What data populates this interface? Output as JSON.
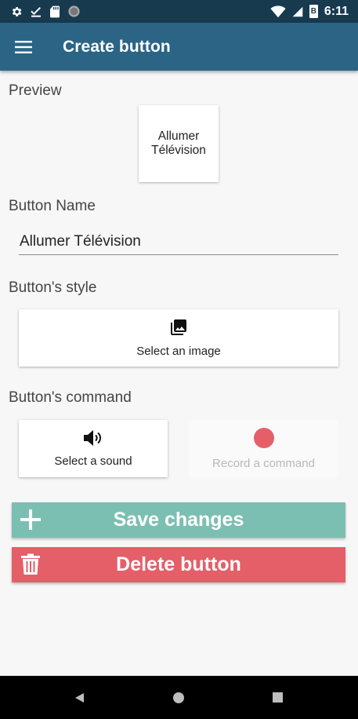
{
  "status_bar": {
    "time": "6:11",
    "battery_glyph": "B",
    "icons": [
      "gear-icon",
      "check-icon",
      "sd-card-icon",
      "circle-icon",
      "wifi-icon",
      "signal-icon",
      "battery-icon"
    ]
  },
  "app_bar": {
    "title": "Create button",
    "menu_icon": "hamburger-menu-icon"
  },
  "preview": {
    "label": "Preview",
    "tile_line1": "Allumer",
    "tile_line2": "Télévision"
  },
  "button_name": {
    "label": "Button Name",
    "value": "Allumer Télévision"
  },
  "style": {
    "label": "Button's style",
    "select_image_label": "Select an image",
    "icon": "photo-library-icon"
  },
  "command": {
    "label": "Button's command",
    "select_sound_label": "Select a sound",
    "sound_icon": "speaker-icon",
    "record_label": "Record a command",
    "record_icon": "record-dot-icon"
  },
  "actions": {
    "save_label": "Save changes",
    "delete_label": "Delete button"
  },
  "colors": {
    "status_bar": "#173a4f",
    "app_bar": "#2c6486",
    "save": "#7bbfb2",
    "delete": "#e45f68",
    "record_dot": "#e45f68"
  },
  "nav_bar": {
    "icons": [
      "back-icon",
      "home-icon",
      "recents-icon"
    ]
  }
}
